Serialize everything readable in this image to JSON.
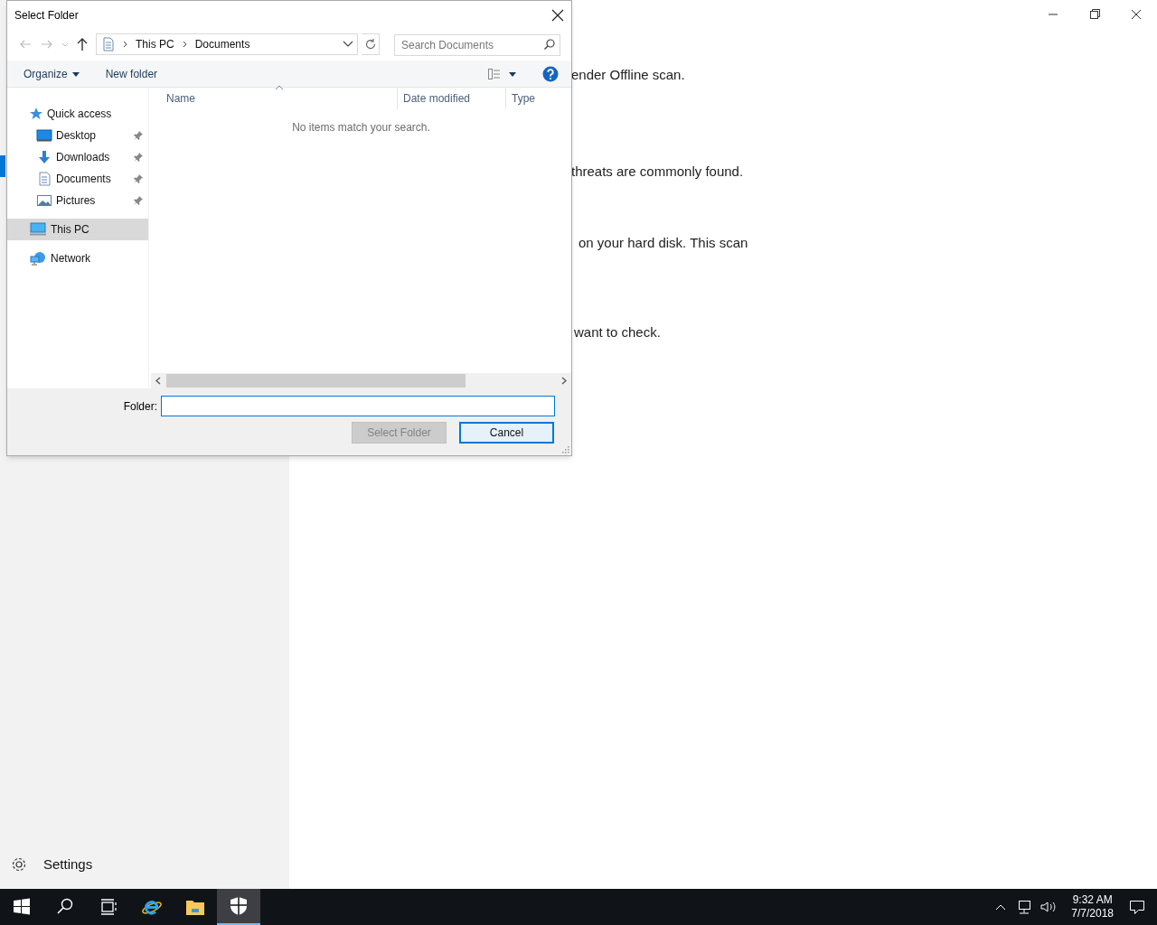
{
  "background_app": {
    "body_lines": [
      "ender Offline scan.",
      "threats are commonly found.",
      "on your hard disk. This scan",
      "want to check."
    ],
    "settings_label": "Settings"
  },
  "dialog": {
    "title": "Select Folder",
    "breadcrumb": [
      "This PC",
      "Documents"
    ],
    "search": {
      "placeholder": "Search Documents"
    },
    "toolbar": {
      "organize": "Organize",
      "new_folder": "New folder"
    },
    "tree": [
      {
        "label": "Quick access",
        "kind": "star",
        "selected": false,
        "children": [
          {
            "label": "Desktop",
            "kind": "desktop",
            "selected": false,
            "pinned": true
          },
          {
            "label": "Downloads",
            "kind": "download",
            "selected": false,
            "pinned": true
          },
          {
            "label": "Documents",
            "kind": "document",
            "selected": false,
            "pinned": true
          },
          {
            "label": "Pictures",
            "kind": "picture",
            "selected": false,
            "pinned": true
          }
        ]
      },
      {
        "label": "This PC",
        "kind": "computer",
        "selected": true
      },
      {
        "label": "Network",
        "kind": "network",
        "selected": false
      }
    ],
    "columns": [
      "Name",
      "Date modified",
      "Type"
    ],
    "empty_message": "No items match your search.",
    "folder_label": "Folder:",
    "buttons": [
      {
        "label": "Select Folder",
        "disabled": true,
        "default": false
      },
      {
        "label": "Cancel",
        "disabled": false,
        "default": true
      }
    ]
  },
  "taskbar": {
    "apps": [
      {
        "kind": "ie",
        "selected": false
      },
      {
        "kind": "explorer",
        "selected": false
      },
      {
        "kind": "shield",
        "selected": true
      }
    ],
    "time": "9:32 AM",
    "date": "7/7/2018"
  }
}
